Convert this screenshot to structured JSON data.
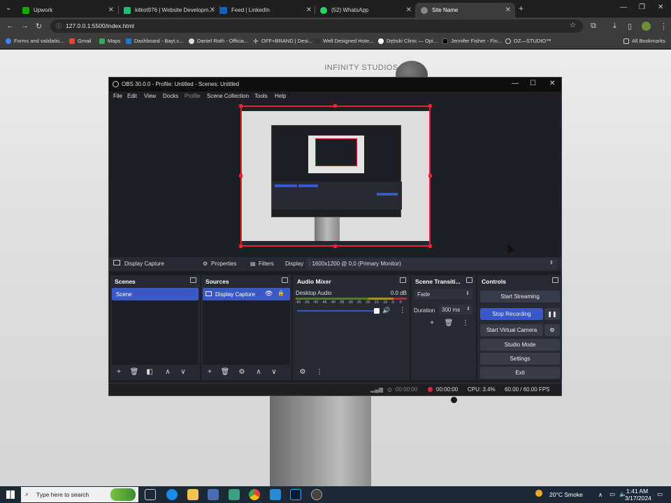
{
  "browser": {
    "tabs": [
      {
        "title": "Upwork",
        "color": "#14a800"
      },
      {
        "title": "kitkot976 | Website Developm...",
        "color": "#1dbf73"
      },
      {
        "title": "Feed | LinkedIn",
        "color": "#0a66c2"
      },
      {
        "title": "(52) WhatsApp",
        "color": "#25d366"
      },
      {
        "title": "Site Name",
        "color": "#888888"
      }
    ],
    "new_tab": "+",
    "url": "127.0.0.1:5500/index.html",
    "bookmarks": [
      {
        "label": "Forms and validatio...",
        "color": "#4285f4"
      },
      {
        "label": "Gmail",
        "color": "#ea4335"
      },
      {
        "label": "Maps",
        "color": "#34a853"
      },
      {
        "label": "Dashboard - Bayt.c...",
        "color": "#1976d2"
      },
      {
        "label": "Daniel Roth - Officia...",
        "color": "#dddddd"
      },
      {
        "label": "OFF+BRAND | Desi...",
        "color": "#eeeeee"
      },
      {
        "label": "Well Designed Hote...",
        "color": "#333333"
      },
      {
        "label": "Dębski Clinic — Opi...",
        "color": "#ffffff"
      },
      {
        "label": "Jennifer Fisher - Fin...",
        "color": "#000000"
      },
      {
        "label": "OZ—STUDIO™",
        "color": "#cccccc"
      }
    ],
    "all_bookmarks": "All Bookmarks"
  },
  "site": {
    "title": "INFINITY STUDIOS"
  },
  "obs": {
    "title": "OBS 30.0.0 - Profile: Untitled - Scenes: Untitled",
    "menu": [
      "File",
      "Edit",
      "View",
      "Docks",
      "Profile",
      "Scene Collection",
      "Tools",
      "Help"
    ],
    "source_bar": {
      "source": "Display Capture",
      "properties": "Properties",
      "filters": "Filters",
      "display_label": "Display",
      "display_value": ": 1600x1200 @ 0,0 (Primary Monitor)"
    },
    "scenes": {
      "title": "Scenes",
      "items": [
        "Scene"
      ]
    },
    "sources": {
      "title": "Sources",
      "items": [
        "Display Capture"
      ]
    },
    "mixer": {
      "title": "Audio Mixer",
      "channel": "Desktop Audio",
      "level": "0.0 dB",
      "ticks": [
        "-60",
        "-55",
        "-50",
        "-45",
        "-40",
        "-35",
        "-30",
        "-25",
        "-20",
        "-15",
        "-10",
        "-5",
        "0"
      ]
    },
    "transitions": {
      "title": "Scene Transiti...",
      "type": "Fade",
      "duration_label": "Duration",
      "duration_value": "300 ms"
    },
    "controls": {
      "title": "Controls",
      "start_streaming": "Start Streaming",
      "stop_recording": "Stop Recording",
      "start_virtual_camera": "Start Virtual Camera",
      "studio_mode": "Studio Mode",
      "settings": "Settings",
      "exit": "Exit"
    },
    "status": {
      "stream_time": "00:00:00",
      "rec_time": "00:00:00",
      "cpu": "CPU: 3.4%",
      "fps": "60.00 / 60.00 FPS"
    }
  },
  "taskbar": {
    "search_placeholder": "Type here to search",
    "weather": "20°C  Smoke",
    "time": "1:41 AM",
    "date": "3/17/2024"
  }
}
